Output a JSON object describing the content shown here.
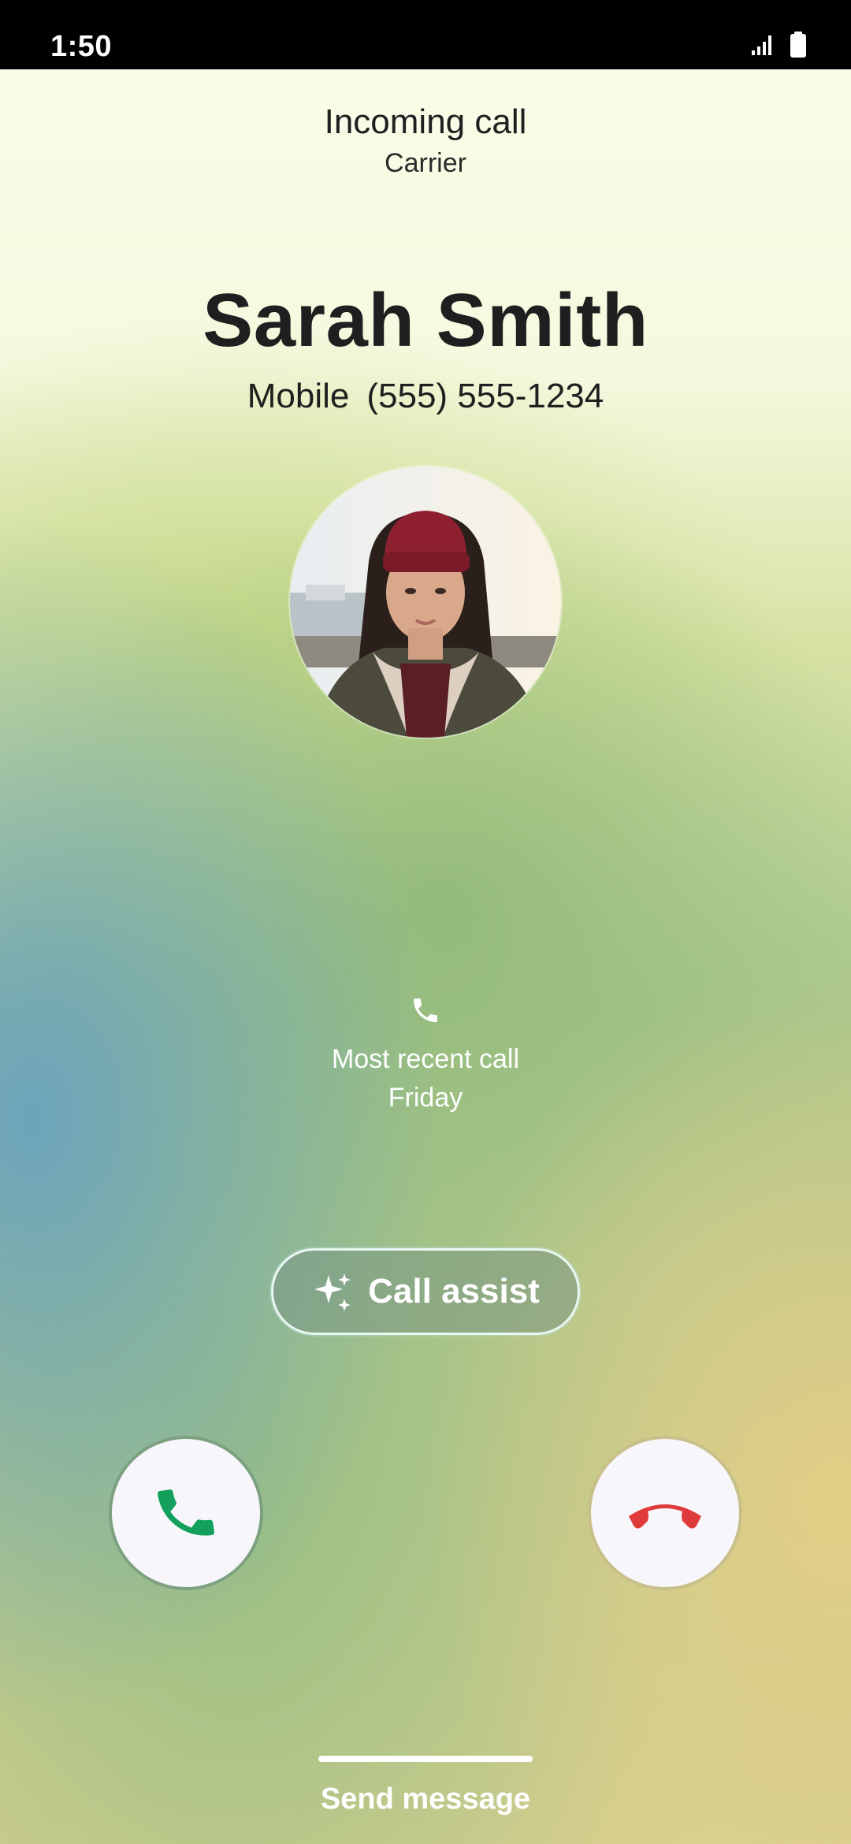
{
  "status_bar": {
    "time": "1:50",
    "icons": [
      "signal-icon",
      "battery-icon"
    ]
  },
  "header": {
    "title": "Incoming call",
    "subtitle": "Carrier"
  },
  "caller": {
    "name": "Sarah Smith",
    "number_type": "Mobile",
    "number": "(555) 555-1234",
    "avatar": "contact-photo"
  },
  "recent": {
    "icon": "phone-icon",
    "label": "Most recent call",
    "day": "Friday"
  },
  "call_assist": {
    "icon": "sparkle-icon",
    "label": "Call assist"
  },
  "actions": {
    "answer_icon": "phone-answer-icon",
    "decline_icon": "phone-decline-icon",
    "answer_color": "#12a05c",
    "decline_color": "#e03b3b"
  },
  "footer": {
    "send_message": "Send message"
  }
}
